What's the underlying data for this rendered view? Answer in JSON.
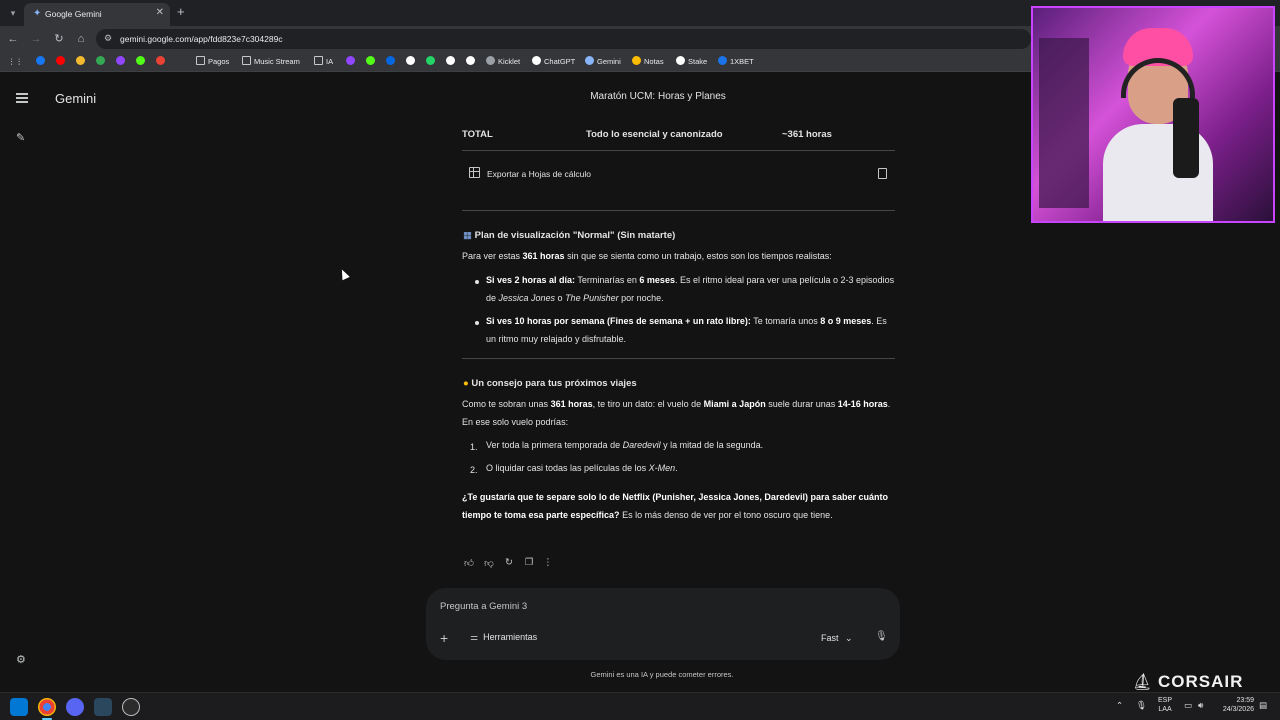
{
  "browser": {
    "tab_title": "Google Gemini",
    "url": "gemini.google.com/app/fdd823e7c304289c",
    "bookmarks": [
      {
        "label": "",
        "icon": "facebook-icon",
        "color": "#1877f2"
      },
      {
        "label": "",
        "icon": "youtube-icon",
        "color": "#ff0000"
      },
      {
        "label": "",
        "icon": "binance-icon",
        "color": "#f3ba2f"
      },
      {
        "label": "",
        "icon": "drive-icon",
        "color": "#34a853"
      },
      {
        "label": "",
        "icon": "twitch-icon",
        "color": "#9146ff"
      },
      {
        "label": "",
        "icon": "kick-icon",
        "color": "#53fc18"
      },
      {
        "label": "",
        "icon": "gmail-icon",
        "color": "#ea4335"
      },
      {
        "label": "Pagos",
        "icon": "folder-icon",
        "color": ""
      },
      {
        "label": "Music Stream",
        "icon": "folder-icon",
        "color": ""
      },
      {
        "label": "IA",
        "icon": "folder-icon",
        "color": ""
      },
      {
        "label": "",
        "icon": "twitch-icon",
        "color": "#9146ff"
      },
      {
        "label": "",
        "icon": "kick-icon",
        "color": "#53fc18"
      },
      {
        "label": "",
        "icon": "meta-icon",
        "color": "#0668e1"
      },
      {
        "label": "",
        "icon": "tiktok-icon",
        "color": "#ffffff"
      },
      {
        "label": "",
        "icon": "app-icon",
        "color": "#25d366"
      },
      {
        "label": "",
        "icon": "x-icon",
        "color": "#ffffff"
      },
      {
        "label": "",
        "icon": "diamond-icon",
        "color": "#ffffff"
      },
      {
        "label": "Kicklet",
        "icon": "kicklet-icon",
        "color": "#9aa0a6"
      },
      {
        "label": "ChatGPT",
        "icon": "chatgpt-icon",
        "color": "#ffffff"
      },
      {
        "label": "Gemini",
        "icon": "gemini-icon",
        "color": "#8ab4f8"
      },
      {
        "label": "Notas",
        "icon": "notes-icon",
        "color": "#fbbc04"
      },
      {
        "label": "Stake",
        "icon": "stake-icon",
        "color": "#ffffff"
      },
      {
        "label": "1XBET",
        "icon": "1xbet-icon",
        "color": "#1a73e8"
      }
    ]
  },
  "app": {
    "brand": "Gemini",
    "conversation_title": "Maratón UCM: Horas y Planes",
    "total_row": {
      "label": "TOTAL",
      "desc": "Todo lo esencial y canonizado",
      "value": "~361 horas"
    },
    "export_label": "Exportar a Hojas de cálculo",
    "plan_heading": "Plan de visualización \"Normal\" (Sin matarte)",
    "plan_intro": [
      {
        "t": "Para ver estas ",
        "b": false
      },
      {
        "t": "361 horas",
        "b": true
      },
      {
        "t": " sin que se sienta como un trabajo, estos son los tiempos realistas:",
        "b": false
      }
    ],
    "plan_items": [
      [
        {
          "t": "Si ves 2 horas al día:",
          "b": true
        },
        {
          "t": " Terminarías en ",
          "b": false
        },
        {
          "t": "6 meses",
          "b": true
        },
        {
          "t": ". Es el ritmo ideal para ver una película o 2-3 episodios de ",
          "b": false
        },
        {
          "t": "Jessica Jones",
          "i": true
        },
        {
          "t": " o ",
          "b": false
        },
        {
          "t": "The Punisher",
          "i": true
        },
        {
          "t": " por noche.",
          "b": false
        }
      ],
      [
        {
          "t": "Si ves 10 horas por semana (Fines de semana + un rato libre):",
          "b": true
        },
        {
          "t": " Te tomaría unos ",
          "b": false
        },
        {
          "t": "8 o 9 meses",
          "b": true
        },
        {
          "t": ". Es un ritmo muy relajado y disfrutable.",
          "b": false
        }
      ]
    ],
    "tip_heading": "Un consejo para tus próximos viajes",
    "tip_intro": [
      {
        "t": "Como te sobran unas ",
        "b": false
      },
      {
        "t": "361 horas",
        "b": true
      },
      {
        "t": ", te tiro un dato: el vuelo de ",
        "b": false
      },
      {
        "t": "Miami a Japón",
        "b": true
      },
      {
        "t": " suele durar unas ",
        "b": false
      },
      {
        "t": "14-16 horas",
        "b": true
      },
      {
        "t": ". En ese solo vuelo podrías:",
        "b": false
      }
    ],
    "tip_items": [
      [
        {
          "t": "Ver toda la primera temporada de ",
          "b": false
        },
        {
          "t": "Daredevil",
          "i": true
        },
        {
          "t": " y la mitad de la segunda.",
          "b": false
        }
      ],
      [
        {
          "t": "O liquidar casi todas las películas de los ",
          "b": false
        },
        {
          "t": "X-Men",
          "i": true
        },
        {
          "t": ".",
          "b": false
        }
      ]
    ],
    "closing": [
      {
        "t": "¿Te gustaría que te separe solo lo de Netflix (Punisher, Jessica Jones, Daredevil) para saber cuánto tiempo te toma esa parte específica?",
        "b": true
      },
      {
        "t": " Es lo más denso de ver por el tono oscuro que tiene.",
        "b": false
      }
    ],
    "prompt_placeholder": "Pregunta a Gemini 3",
    "tools_label": "Herramientas",
    "model_label": "Fast",
    "disclaimer": "Gemini es una IA y puede cometer errores."
  },
  "overlay": {
    "brand": "CORSAIR"
  },
  "taskbar": {
    "lang_1": "ESP",
    "lang_2": "LAA",
    "time": "23:59",
    "date": "24/3/2026"
  },
  "colors": {
    "background": "#131314",
    "surface": "#1e1f20",
    "text": "#e3e3e3",
    "webcam_border": "#c844ff"
  }
}
